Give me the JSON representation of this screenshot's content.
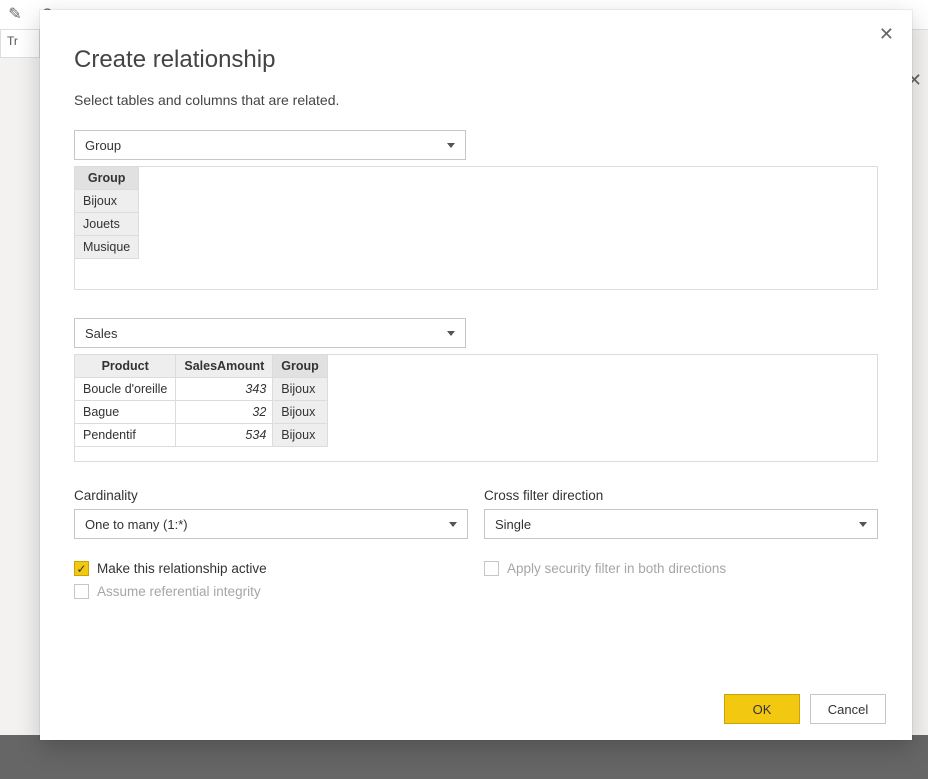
{
  "bg": {
    "tab_fragment": "Tr"
  },
  "dialog": {
    "title": "Create relationship",
    "subtitle": "Select tables and columns that are related.",
    "table1": {
      "selected": "Group",
      "columns": [
        "Group"
      ],
      "rows": [
        [
          "Bijoux"
        ],
        [
          "Jouets"
        ],
        [
          "Musique"
        ]
      ],
      "selected_column_index": 0
    },
    "table2": {
      "selected": "Sales",
      "columns": [
        "Product",
        "SalesAmount",
        "Group"
      ],
      "rows": [
        [
          "Boucle d'oreille",
          "343",
          "Bijoux"
        ],
        [
          "Bague",
          "32",
          "Bijoux"
        ],
        [
          "Pendentif",
          "534",
          "Bijoux"
        ]
      ],
      "numeric_column_indexes": [
        1
      ],
      "selected_column_index": 2
    },
    "cardinality": {
      "label": "Cardinality",
      "value": "One to many (1:*)"
    },
    "cross_filter": {
      "label": "Cross filter direction",
      "value": "Single"
    },
    "checks": {
      "active": {
        "label": "Make this relationship active",
        "checked": true,
        "enabled": true
      },
      "assume_ri": {
        "label": "Assume referential integrity",
        "checked": false,
        "enabled": false
      },
      "security_filter": {
        "label": "Apply security filter in both directions",
        "checked": false,
        "enabled": false
      }
    },
    "buttons": {
      "ok": "OK",
      "cancel": "Cancel"
    }
  }
}
